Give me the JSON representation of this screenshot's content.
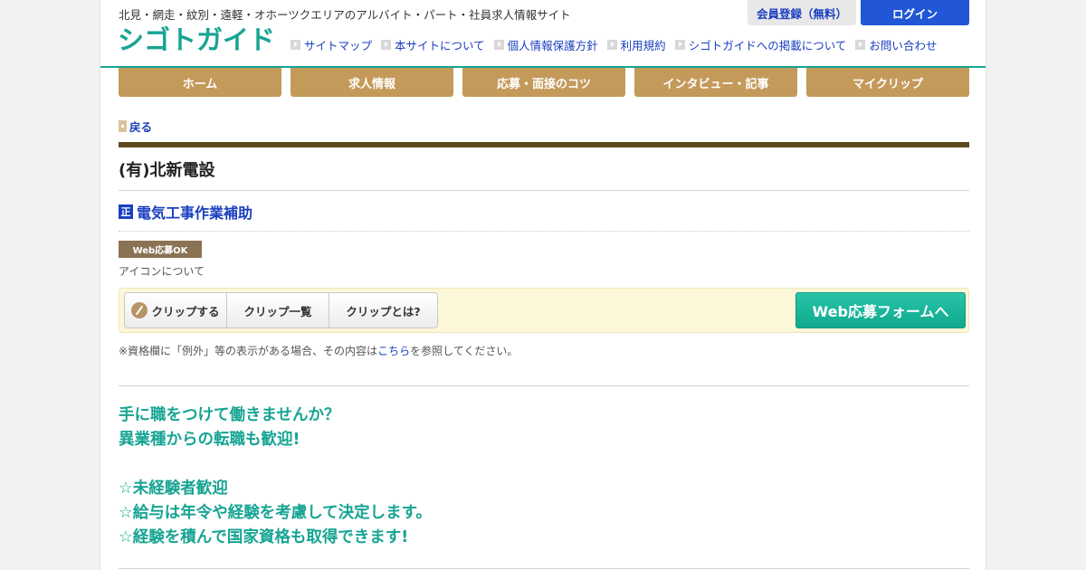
{
  "header": {
    "tagline": "北見・網走・紋別・遠軽・オホーツクエリアのアルバイト・パート・社員求人情報サイト",
    "logo_text": "シゴトガイド",
    "register_label": "会員登録（無料）",
    "login_label": "ログイン",
    "util_links": [
      "サイトマップ",
      "本サイトについて",
      "個人情報保護方針",
      "利用規約",
      "シゴトガイドへの掲載について",
      "お問い合わせ"
    ]
  },
  "nav": {
    "items": [
      "ホーム",
      "求人情報",
      "応募・面接のコツ",
      "インタビュー・記事",
      "マイクリップ"
    ]
  },
  "main": {
    "back_label": "戻る",
    "company_name": "(有)北新電設",
    "employment_icon": "正",
    "job_title": "電気工事作業補助",
    "badge": "Web応募OK",
    "icon_about": "アイコンについて",
    "clip_buttons": [
      "クリップする",
      "クリップ一覧",
      "クリップとは?"
    ],
    "apply_button": "Web応募フォームへ",
    "note_prefix": "※資格欄に「例外」等の表示がある場合、その内容は",
    "note_link": "こちら",
    "note_suffix": "を参照してください。",
    "catch_lines": [
      "手に職をつけて働きませんか？",
      "異業種からの転職も歓迎!",
      "",
      "☆未経験者歓迎",
      "☆給与は年令や経験を考慮して決定します。",
      "☆経験を積んで国家資格も取得できます!"
    ]
  },
  "colors": {
    "brand": "#17a493",
    "nav_bg": "#c49a5a",
    "link": "#1a3fbf",
    "company_bar": "#5c4a1e"
  }
}
